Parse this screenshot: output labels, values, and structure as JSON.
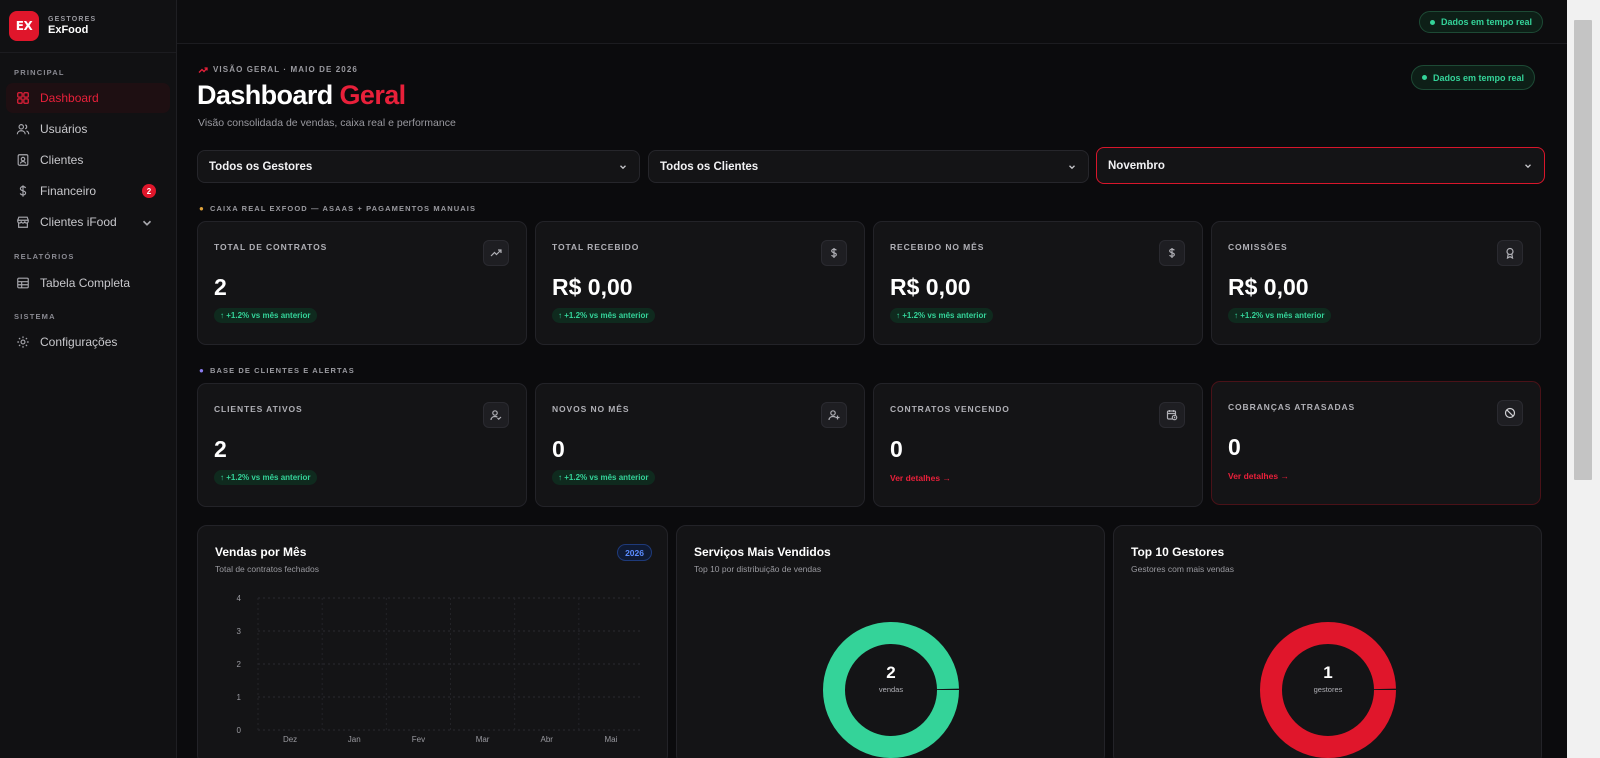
{
  "brand": {
    "logo_text": "EX",
    "eyebrow": "GESTORES",
    "name": "ExFood"
  },
  "sidebar": {
    "sections": [
      "PRINCIPAL",
      "RELATÓRIOS",
      "SISTEMA"
    ],
    "items": [
      {
        "label": "Dashboard",
        "icon": "grid-icon",
        "active": true
      },
      {
        "label": "Usuários",
        "icon": "users-icon"
      },
      {
        "label": "Clientes",
        "icon": "contact-icon"
      },
      {
        "label": "Financeiro",
        "icon": "dollar-icon",
        "badge": "2"
      },
      {
        "label": "Clientes iFood",
        "icon": "store-icon",
        "expandable": true
      },
      {
        "label": "Tabela Completa",
        "icon": "table-icon"
      },
      {
        "label": "Configurações",
        "icon": "gear-icon"
      }
    ]
  },
  "topbar": {
    "live_label": "Dados em tempo real"
  },
  "header": {
    "eyebrow": "VISÃO GERAL · MAIO DE 2026",
    "title_main": "Dashboard",
    "title_accent": "Geral",
    "subtitle": "Visão consolidada de vendas, caixa real e performance",
    "live_label": "Dados em tempo real"
  },
  "filters": {
    "gestores": "Todos os Gestores",
    "clientes": "Todos os Clientes",
    "mes": "Novembro"
  },
  "section_caixa": "CAIXA REAL EXFOOD — ASAAS + PAGAMENTOS MANUAIS",
  "kpis_caixa": [
    {
      "label": "TOTAL DE CONTRATOS",
      "value": "2",
      "delta": "↑ +1.2% vs mês anterior",
      "icon": "trending-up-icon"
    },
    {
      "label": "TOTAL RECEBIDO",
      "value": "R$ 0,00",
      "delta": "↑ +1.2% vs mês anterior",
      "icon": "dollar-icon"
    },
    {
      "label": "RECEBIDO NO MÊS",
      "value": "R$ 0,00",
      "delta": "↑ +1.2% vs mês anterior",
      "icon": "dollar-icon"
    },
    {
      "label": "COMISSÕES",
      "value": "R$ 0,00",
      "delta": "↑ +1.2% vs mês anterior",
      "icon": "award-icon"
    }
  ],
  "section_base": "BASE DE CLIENTES E ALERTAS",
  "kpis_base": [
    {
      "label": "CLIENTES ATIVOS",
      "value": "2",
      "delta": "↑ +1.2% vs mês anterior",
      "icon": "user-check-icon"
    },
    {
      "label": "NOVOS NO MÊS",
      "value": "0",
      "delta": "↑ +1.2% vs mês anterior",
      "icon": "user-plus-icon"
    },
    {
      "label": "CONTRATOS VENCENDO",
      "value": "0",
      "link": "Ver detalhes →",
      "icon": "calendar-clock-icon"
    },
    {
      "label": "COBRANÇAS ATRASADAS",
      "value": "0",
      "link": "Ver detalhes →",
      "icon": "ban-icon",
      "alert": true
    }
  ],
  "panels": {
    "vendas": {
      "title": "Vendas por Mês",
      "subtitle": "Total de contratos fechados",
      "year": "2026"
    },
    "servicos": {
      "title": "Serviços Mais Vendidos",
      "subtitle": "Top 10 por distribuição de vendas",
      "center_value": "2",
      "center_label": "vendas"
    },
    "gestores": {
      "title": "Top 10 Gestores",
      "subtitle": "Gestores com mais vendas",
      "center_value": "1",
      "center_label": "gestores"
    }
  },
  "chart_data": [
    {
      "type": "bar",
      "title": "Vendas por Mês",
      "categories": [
        "Dez",
        "Jan",
        "Fev",
        "Mar",
        "Abr",
        "Mai"
      ],
      "values": [
        0,
        0,
        0,
        0,
        0,
        0
      ],
      "ylim": [
        0,
        4
      ],
      "yticks": [
        "4",
        "3",
        "2",
        "1",
        "0"
      ],
      "grid": true
    },
    {
      "type": "pie",
      "title": "Serviços Mais Vendidos",
      "values": [
        2
      ],
      "colors": [
        "#34d399"
      ]
    },
    {
      "type": "pie",
      "title": "Top 10 Gestores",
      "values": [
        1
      ],
      "colors": [
        "#e0162b"
      ]
    }
  ],
  "colors": {
    "accent": "#e8203a",
    "success": "#34d399",
    "info": "#5b8cff",
    "background": "#0b0b0d",
    "card": "#141416"
  }
}
